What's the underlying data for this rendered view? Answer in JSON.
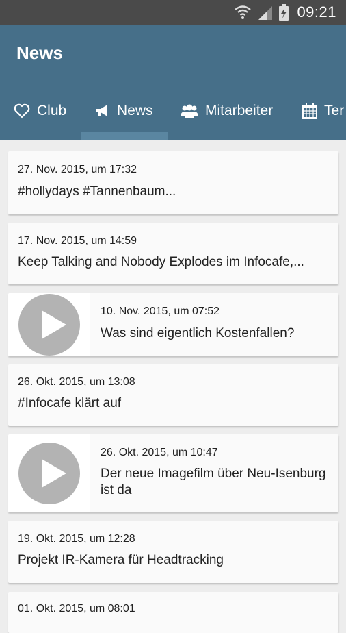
{
  "status": {
    "time": "09:21"
  },
  "appbar": {
    "title": "News"
  },
  "tabs": [
    {
      "label": "Club",
      "icon": "heart-outline-icon"
    },
    {
      "label": "News",
      "icon": "megaphone-icon"
    },
    {
      "label": "Mitarbeiter",
      "icon": "users-icon"
    },
    {
      "label": "Ter",
      "icon": "calendar-icon"
    }
  ],
  "news": [
    {
      "date": "27. Nov. 2015, um 17:32",
      "text": "#hollydays #Tannenbaum..."
    },
    {
      "date": "17. Nov. 2015, um 14:59",
      "text": "Keep Talking and Nobody Explodes im Infocafe,..."
    },
    {
      "date": "10. Nov. 2015, um 07:52",
      "text": "Was sind eigentlich Kostenfallen?",
      "video": true
    },
    {
      "date": "26. Okt. 2015, um 13:08",
      "text": "#Infocafe klärt auf"
    },
    {
      "date": "26. Okt. 2015, um 10:47",
      "text": "Der neue Imagefilm über Neu-Isenburg ist da",
      "video": true
    },
    {
      "date": "19. Okt. 2015, um 12:28",
      "text": "Projekt IR-Kamera für Headtracking"
    },
    {
      "date": "01. Okt. 2015, um 08:01",
      "text": ""
    }
  ],
  "colors": {
    "appbar": "#466f89",
    "statusbar": "#4a4a4a",
    "background": "#ededed"
  }
}
